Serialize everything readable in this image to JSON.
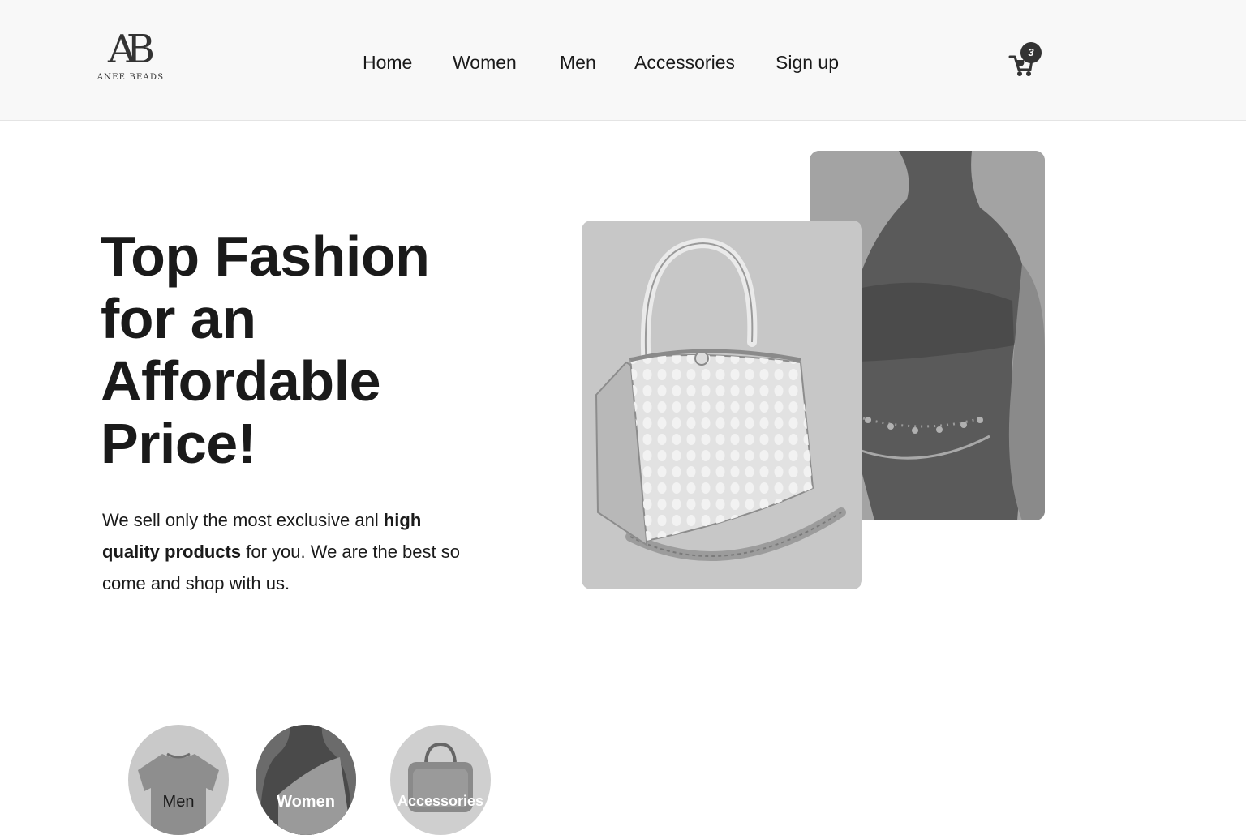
{
  "brand": {
    "logo_mark": "AB",
    "logo_text": "ANEE BEADS"
  },
  "nav": {
    "items": [
      {
        "label": "Home"
      },
      {
        "label": "Women"
      },
      {
        "label": "Men"
      },
      {
        "label": "Accessories"
      },
      {
        "label": "Sign up"
      }
    ]
  },
  "cart": {
    "count": "3",
    "icon": "cart-icon"
  },
  "hero": {
    "title": "Top Fashion for an Affordable Price!",
    "description_part1": "We sell only the most exclusive anl ",
    "description_bold": "high quality products",
    "description_part2": " for you. We are the best so come and shop with us."
  },
  "images": {
    "front": "beaded-handbag-image",
    "back": "waist-bead-chain-model-image"
  },
  "categories": [
    {
      "label": "Men",
      "image": "tshirt-image"
    },
    {
      "label": "Women",
      "image": "woman-top-image"
    },
    {
      "label": "Accessories",
      "image": "handbag-image"
    }
  ],
  "colors": {
    "header_bg": "#f8f8f8",
    "text": "#1a1a1a",
    "badge": "#333333"
  }
}
